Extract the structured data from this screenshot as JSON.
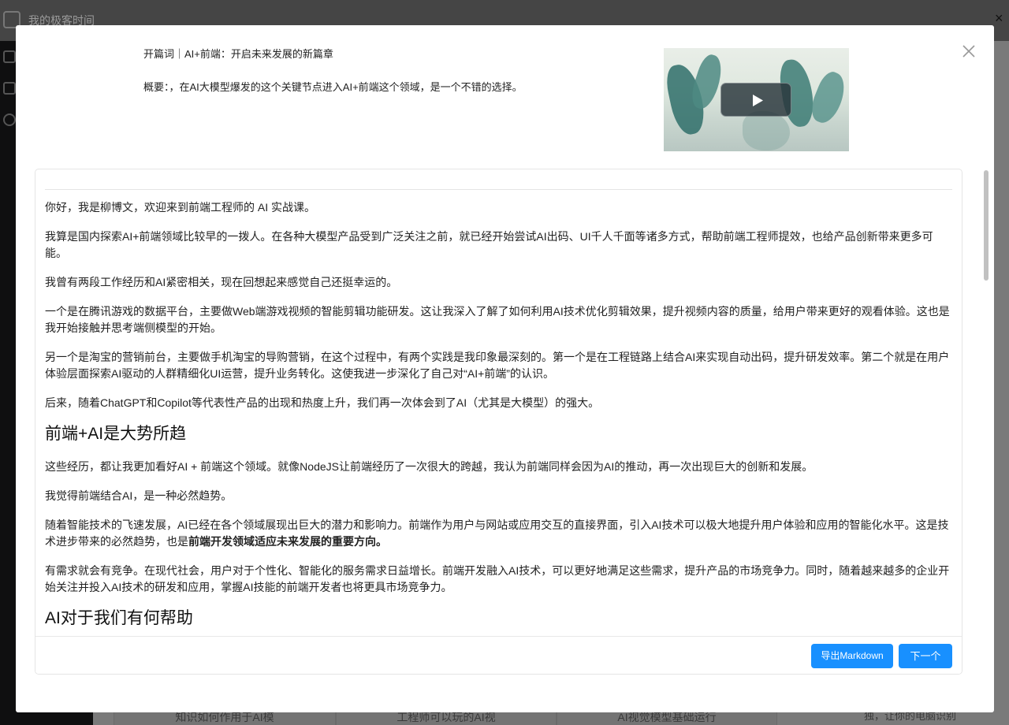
{
  "background": {
    "app_title": "我的极客时间",
    "cards": [
      "知识如何作用于AI模",
      "工程师可以玩的AI视",
      "AI视觉模型基础运行"
    ],
    "bottom_right_text": "独，让你的电脑识别",
    "close_symbol": "×"
  },
  "modal": {
    "title": "开篇词｜AI+前端：开启未来发展的新篇章",
    "summary": "概要：，在AI大模型爆发的这个关键节点进入AI+前端这个领域，是一个不错的选择。",
    "video": {
      "play_icon": "play-icon",
      "thumbnail": "ink-landscape"
    },
    "close_icon": "close-icon"
  },
  "article": {
    "p1": "你好，我是柳博文，欢迎来到前端工程师的 AI 实战课。",
    "p2": "我算是国内探索AI+前端领域比较早的一拨人。在各种大模型产品受到广泛关注之前，就已经开始尝试AI出码、UI千人千面等诸多方式，帮助前端工程师提效，也给产品创新带来更多可能。",
    "p3": "我曾有两段工作经历和AI紧密相关，现在回想起来感觉自己还挺幸运的。",
    "p4": "一个是在腾讯游戏的数据平台，主要做Web端游戏视频的智能剪辑功能研发。这让我深入了解了如何利用AI技术优化剪辑效果，提升视频内容的质量，给用户带来更好的观看体验。这也是我开始接触并思考端侧模型的开始。",
    "p5": "另一个是淘宝的营销前台，主要做手机淘宝的导购营销，在这个过程中，有两个实践是我印象最深刻的。第一个是在工程链路上结合AI来实现自动出码，提升研发效率。第二个就是在用户体验层面探索AI驱动的人群精细化UI运营，提升业务转化。这使我进一步深化了自己对“AI+前端”的认识。",
    "p6": "后来，随着ChatGPT和Copilot等代表性产品的出现和热度上升，我们再一次体会到了AI（尤其是大模型）的强大。",
    "h1": "前端+AI是大势所趋",
    "p7": "这些经历，都让我更加看好AI + 前端这个领域。就像NodeJS让前端经历了一次很大的跨越，我认为前端同样会因为AI的推动，再一次出现巨大的创新和发展。",
    "p8": "我觉得前端结合AI，是一种必然趋势。",
    "p9a": "随着智能技术的飞速发展，AI已经在各个领域展现出巨大的潜力和影响力。前端作为用户与网站或应用交互的直接界面，引入AI技术可以极大地提升用户体验和应用的智能化水平。这是技术进步带来的必然趋势，也是",
    "p9b": "前端开发领域适应未来发展的重要方向。",
    "p10": "有需求就会有竞争。在现代社会，用户对于个性化、智能化的服务需求日益增长。前端开发融入AI技术，可以更好地满足这些需求，提升产品的市场竞争力。同时，随着越来越多的企业开始关注并投入AI技术的研发和应用，掌握AI技能的前端开发者也将更具市场竞争力。",
    "h2": "AI对于我们有何帮助"
  },
  "footer": {
    "export_label": "导出Markdown",
    "next_label": "下一个"
  },
  "colors": {
    "primary": "#1890ff",
    "overlay": "#6b6b6b"
  }
}
